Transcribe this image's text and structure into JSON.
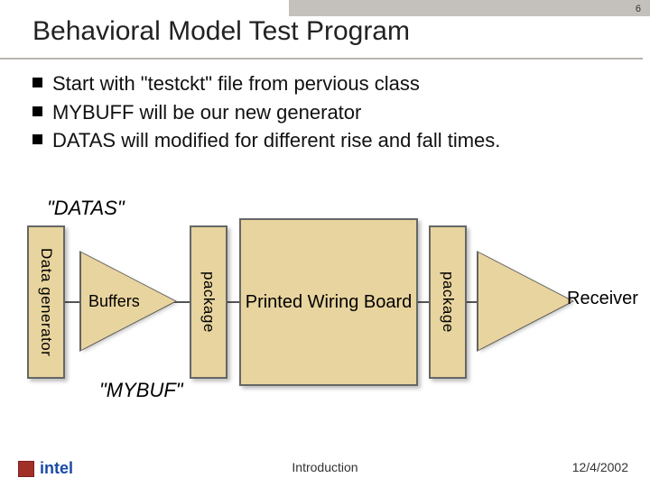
{
  "page_number": "6",
  "title": "Behavioral Model Test Program",
  "bullets": [
    "Start with \"testckt\" file from pervious class",
    "MYBUFF will be our new generator",
    "DATAS will modified for different rise and fall times."
  ],
  "labels": {
    "datas": "\"DATAS\"",
    "mybuf": "\"MYBUF\""
  },
  "diagram": {
    "data_generator": "Data generator",
    "buffers": "Buffers",
    "package1": "package",
    "pwb": "Printed Wiring Board",
    "package2": "package",
    "receiver": "Receiver"
  },
  "footer": {
    "center": "Introduction",
    "date": "12/4/2002",
    "logo_text": "intel"
  },
  "colors": {
    "box_fill": "#e8d49e",
    "box_border": "#666",
    "topbar": "#c4c0bc"
  }
}
